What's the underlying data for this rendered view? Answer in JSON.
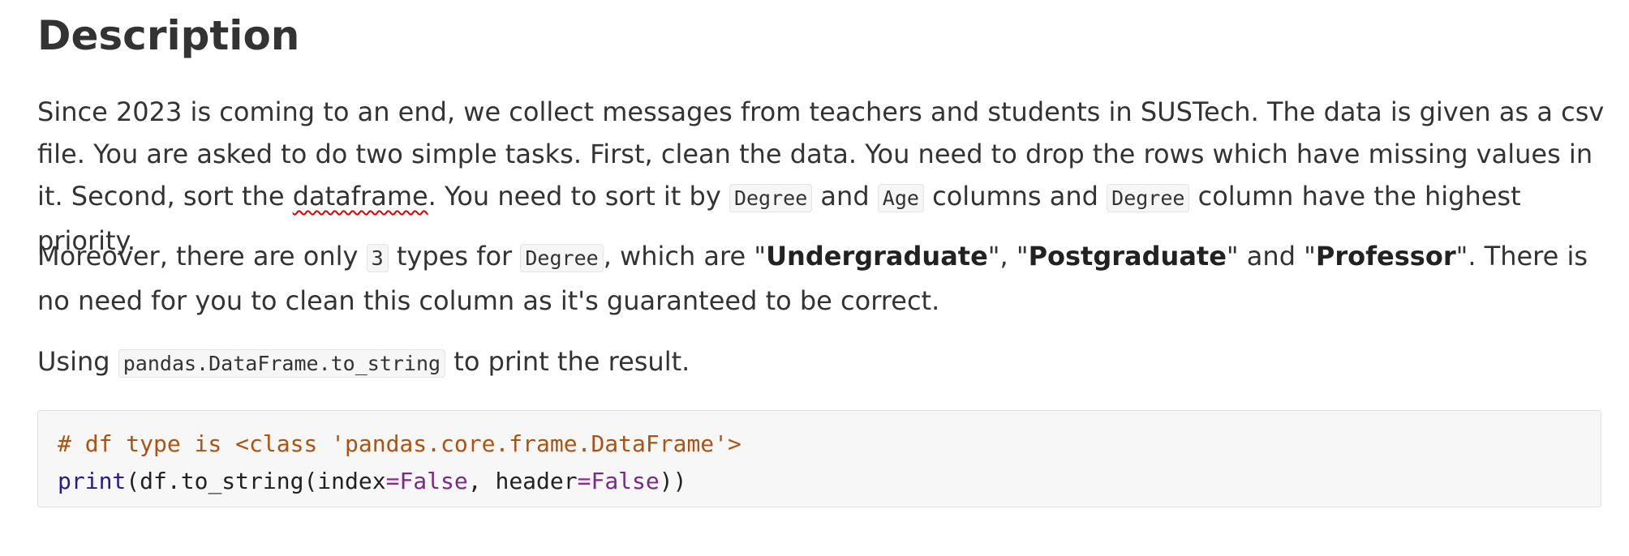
{
  "heading": "Description",
  "paragraph1": {
    "t1": "Since 2023 is coming to an end, we collect messages from teachers and students in SUSTech. The data is given as a csv file. You are asked to do two simple tasks. First, clean the data. You need to drop the rows which have missing values in it. Second, sort the ",
    "misspelled": "dataframe",
    "t2": ". You need to sort it by ",
    "code1": "Degree",
    "t3": " and ",
    "code2": "Age",
    "t4": " columns and ",
    "code3": "Degree",
    "t5": " column have the highest priority."
  },
  "paragraph2": {
    "t1": "Moreover, there are only ",
    "code1": "3",
    "t2": " types for ",
    "code2": "Degree",
    "t3": ", which are \"",
    "bold1": "Undergraduate",
    "t4": "\", \"",
    "bold2": "Postgraduate",
    "t5": "\" and \"",
    "bold3": "Professor",
    "t6": "\". There is no need for you to clean this column as it's guaranteed to be correct."
  },
  "paragraph3": {
    "t1": "Using ",
    "code1": "pandas.DataFrame.to_string",
    "t2": " to print the result."
  },
  "code_block": {
    "comment": "# df type is <class 'pandas.core.frame.DataFrame'>",
    "print_fn": "print",
    "part1": "(df.to_string(index",
    "eq1": "=",
    "false1": "False",
    "part2": ", header",
    "eq2": "=",
    "false2": "False",
    "part3": "))"
  },
  "colors": {
    "text": "#333333",
    "comment": "#b0520f",
    "builtin": "#2b1a8a",
    "keyword": "#7a2a86",
    "spellcheck": "#e00000"
  }
}
